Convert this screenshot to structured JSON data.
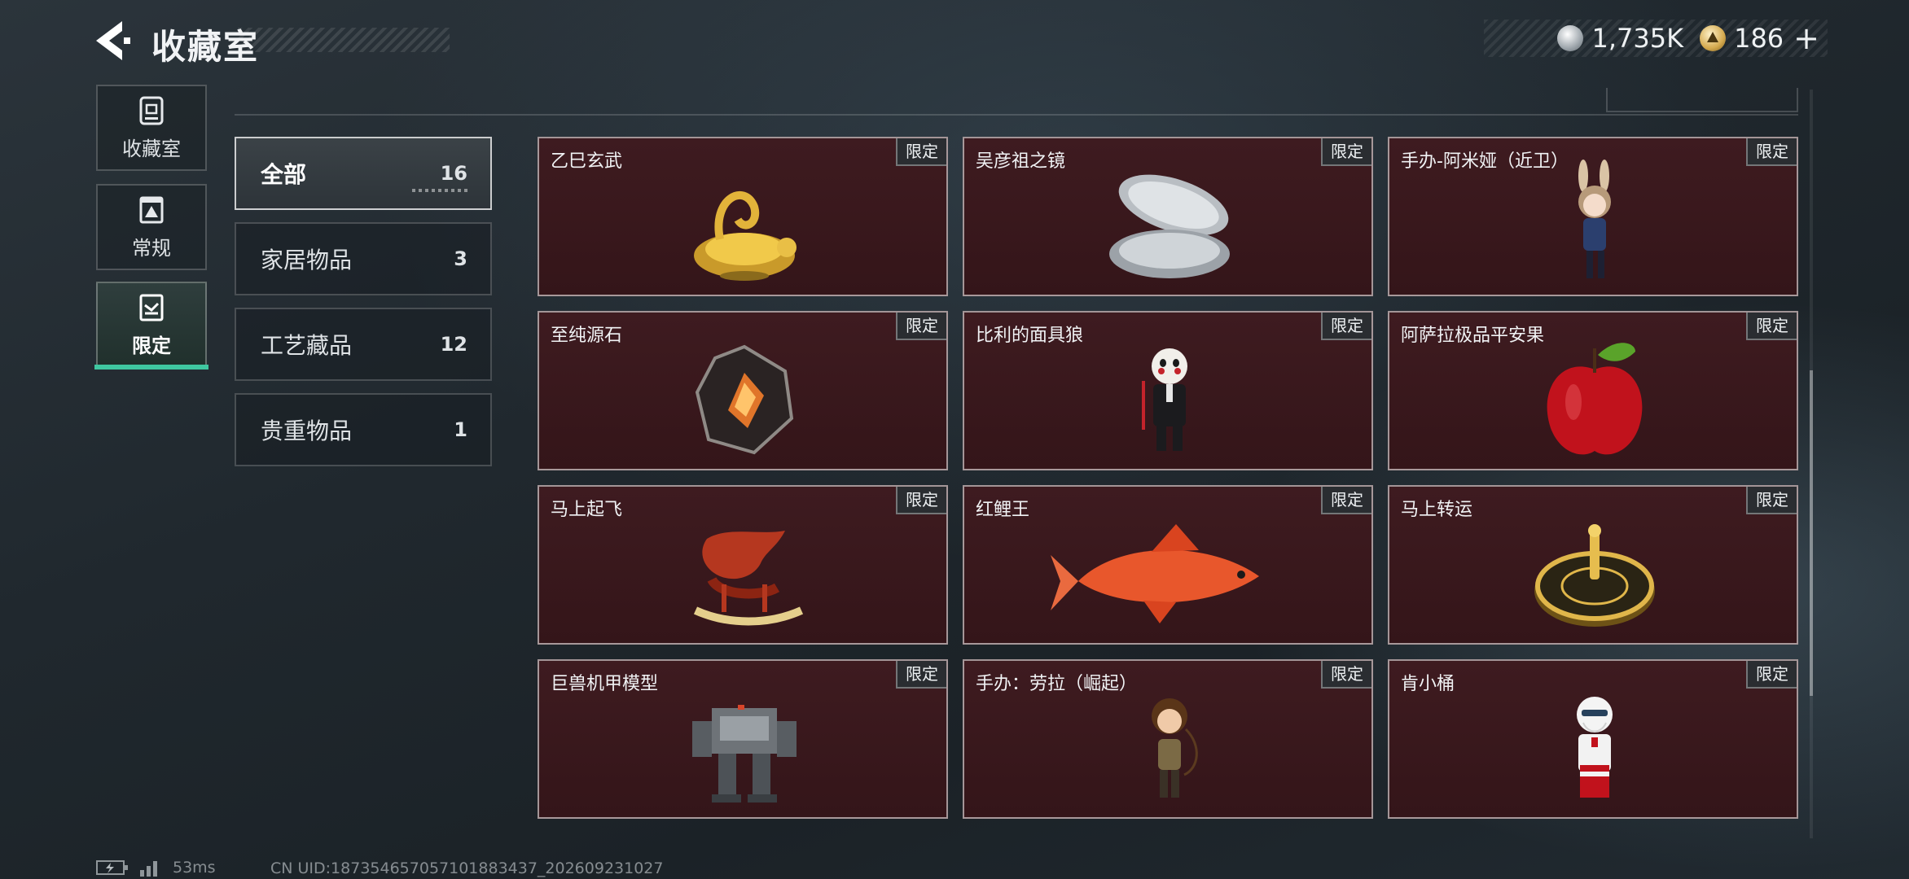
{
  "header": {
    "title": "收藏室",
    "currencies": [
      {
        "icon": "silver-coin-icon",
        "value": "1,735K"
      },
      {
        "icon": "gold-coin-icon",
        "value": "186"
      }
    ],
    "add_symbol": "+"
  },
  "nav": [
    {
      "label": "收藏室",
      "icon": "collection-room-icon",
      "active": false
    },
    {
      "label": "常规",
      "icon": "regular-items-icon",
      "active": false
    },
    {
      "label": "限定",
      "icon": "limited-items-icon",
      "active": true
    }
  ],
  "categories": [
    {
      "label": "全部",
      "count": "16",
      "active": true
    },
    {
      "label": "家居物品",
      "count": "3",
      "active": false
    },
    {
      "label": "工艺藏品",
      "count": "12",
      "active": false
    },
    {
      "label": "贵重物品",
      "count": "1",
      "active": false
    }
  ],
  "badge_label": "限定",
  "items": [
    {
      "name": "乙巳玄武",
      "icon": "golden-dragon-turtle-icon"
    },
    {
      "name": "吴彦祖之镜",
      "icon": "compact-mirror-icon"
    },
    {
      "name": "手办-阿米娅（近卫）",
      "icon": "bunny-girl-figure-icon"
    },
    {
      "name": "至纯源石",
      "icon": "originium-crystal-icon"
    },
    {
      "name": "比利的面具狼",
      "icon": "billy-puppet-icon"
    },
    {
      "name": "阿萨拉极品平安果",
      "icon": "red-apple-icon"
    },
    {
      "name": "马上起飞",
      "icon": "rocking-horse-icon"
    },
    {
      "name": "红鲤王",
      "icon": "red-carp-icon"
    },
    {
      "name": "马上转运",
      "icon": "golden-compass-icon"
    },
    {
      "name": "巨兽机甲模型",
      "icon": "mech-model-icon"
    },
    {
      "name": "手办：劳拉（崛起）",
      "icon": "lara-figure-icon"
    },
    {
      "name": "肯小桶",
      "icon": "colonel-figure-icon"
    }
  ],
  "footer": {
    "ping": "53ms",
    "uid": "CN UID:18735465705710188343​7_202609231027"
  },
  "colors": {
    "accent": "#3fc7a0",
    "card_bg": "#3a181c"
  }
}
